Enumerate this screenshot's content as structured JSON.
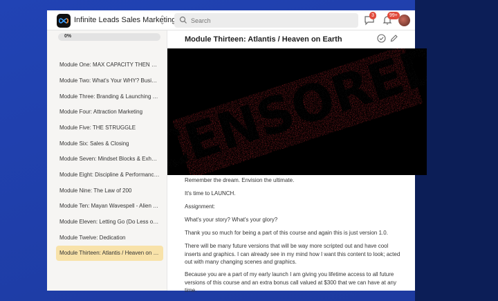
{
  "app": {
    "title": "Infinite Leads Sales Marketing"
  },
  "search": {
    "placeholder": "Search"
  },
  "notifications": {
    "chat_count": "3",
    "bell_count": "99+"
  },
  "sidebar": {
    "progress": "0%",
    "items": [
      {
        "label": "Module One: MAX CAPACITY THEN SCALE",
        "active": false
      },
      {
        "label": "Module Two: What's Your WHY? Business ...",
        "active": false
      },
      {
        "label": "Module Three: Branding & Launching Your...",
        "active": false
      },
      {
        "label": "Module Four: Attraction Marketing",
        "active": false
      },
      {
        "label": "Module Five: THE STRUGGLE",
        "active": false
      },
      {
        "label": "Module Six: Sales & Closing",
        "active": false
      },
      {
        "label": "Module Seven: Mindset Blocks & Exhausti...",
        "active": false
      },
      {
        "label": "Module Eight: Discipline & Performance E...",
        "active": false
      },
      {
        "label": "Module Nine: The Law of 200",
        "active": false
      },
      {
        "label": "Module Ten: Mayan Wavespell - Alien Tec...",
        "active": false
      },
      {
        "label": "Module Eleven: Letting Go (Do Less of This)",
        "active": false
      },
      {
        "label": "Module Twelve: Dedication",
        "active": false
      },
      {
        "label": "Module Thirteen: Atlantis / Heaven on Earth",
        "active": true
      }
    ]
  },
  "main": {
    "title": "Module Thirteen: Atlantis / Heaven on Earth",
    "censor_text": "CENSORED",
    "paragraphs": [
      "Remember the dream. Envision the ultimate.",
      "It's time to LAUNCH.",
      "Assignment:",
      "What's your story? What's your glory?",
      "Thank you so much for being a part of this course and again this is just version 1.0.",
      "There will be many future versions that will be way more scripted out and have cool inserts and graphics. I can already see in my mind how I want this content to look; acted out with many changing scenes and graphics.",
      "Because you are a part of my early launch I am giving you lifetime access to all future versions of this course and an extra bonus call valued at $300 that we can have at any time."
    ]
  },
  "colors": {
    "accent_active": "#f8e2a9",
    "badge": "#e14a3b",
    "censor_red": "#c8282f"
  }
}
